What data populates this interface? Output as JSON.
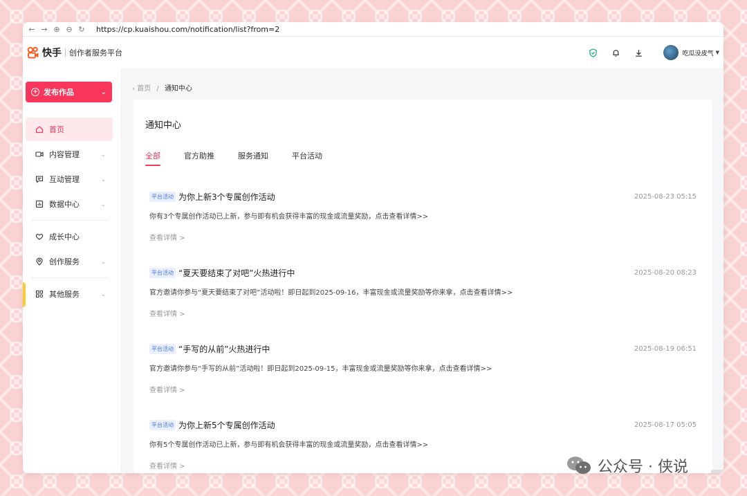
{
  "browser": {
    "url": "https://cp.kuaishou.com/notification/list?from=2"
  },
  "header": {
    "logo_text": "快手",
    "subtitle": "创作者服务平台",
    "username": "吃瓜没皮气"
  },
  "sidebar": {
    "publish_label": "发布作品",
    "items": [
      {
        "label": "首页",
        "icon": "home-icon"
      },
      {
        "label": "内容管理",
        "icon": "video-icon"
      },
      {
        "label": "互动管理",
        "icon": "comment-icon"
      },
      {
        "label": "数据中心",
        "icon": "chart-icon"
      },
      {
        "label": "成长中心",
        "icon": "heart-icon"
      },
      {
        "label": "创作服务",
        "icon": "location-icon"
      },
      {
        "label": "其他服务",
        "icon": "apps-icon"
      }
    ]
  },
  "breadcrumb": {
    "home": "首页",
    "sep": "/",
    "current": "通知中心"
  },
  "panel": {
    "title": "通知中心",
    "tabs": [
      "全部",
      "官方助推",
      "服务通知",
      "平台活动"
    ]
  },
  "notices": [
    {
      "badge": "平台活动",
      "title": "为你上新3个专属创作活动",
      "time": "2025-08-23 05:15",
      "desc": "你有3个专属创作活动已上新，参与即有机会获得丰富的现金或流量奖励，点击查看详情>>",
      "link": "查看详情 >"
    },
    {
      "badge": "平台活动",
      "title": "“夏天要结束了对吧”火热进行中",
      "time": "2025-08-20 08:23",
      "desc": "官方邀请你参与“夏天要结束了对吧”活动啦！即日起到2025-09-16，丰富现金或流量奖励等你来拿，点击查看详情>>",
      "link": "查看详情 >"
    },
    {
      "badge": "平台活动",
      "title": "“手写的从前”火热进行中",
      "time": "2025-08-19 06:51",
      "desc": "官方邀请你参与“手写的从前”活动啦！即日起到2025-09-15，丰富现金或流量奖励等你来拿，点击查看详情>>",
      "link": "查看详情 >"
    },
    {
      "badge": "平台活动",
      "title": "为你上新5个专属创作活动",
      "time": "2025-08-17 05:05",
      "desc": "你有5个专属创作活动已上新，参与即有机会获得丰富的现金或流量奖励，点击查看详情>>",
      "link": "查看详情 >"
    }
  ],
  "watermark": {
    "text": "公众号 · 侠说"
  },
  "colors": {
    "accent": "#f8355a",
    "badge": "#4a7bdc",
    "background": "#f9d2d2"
  }
}
